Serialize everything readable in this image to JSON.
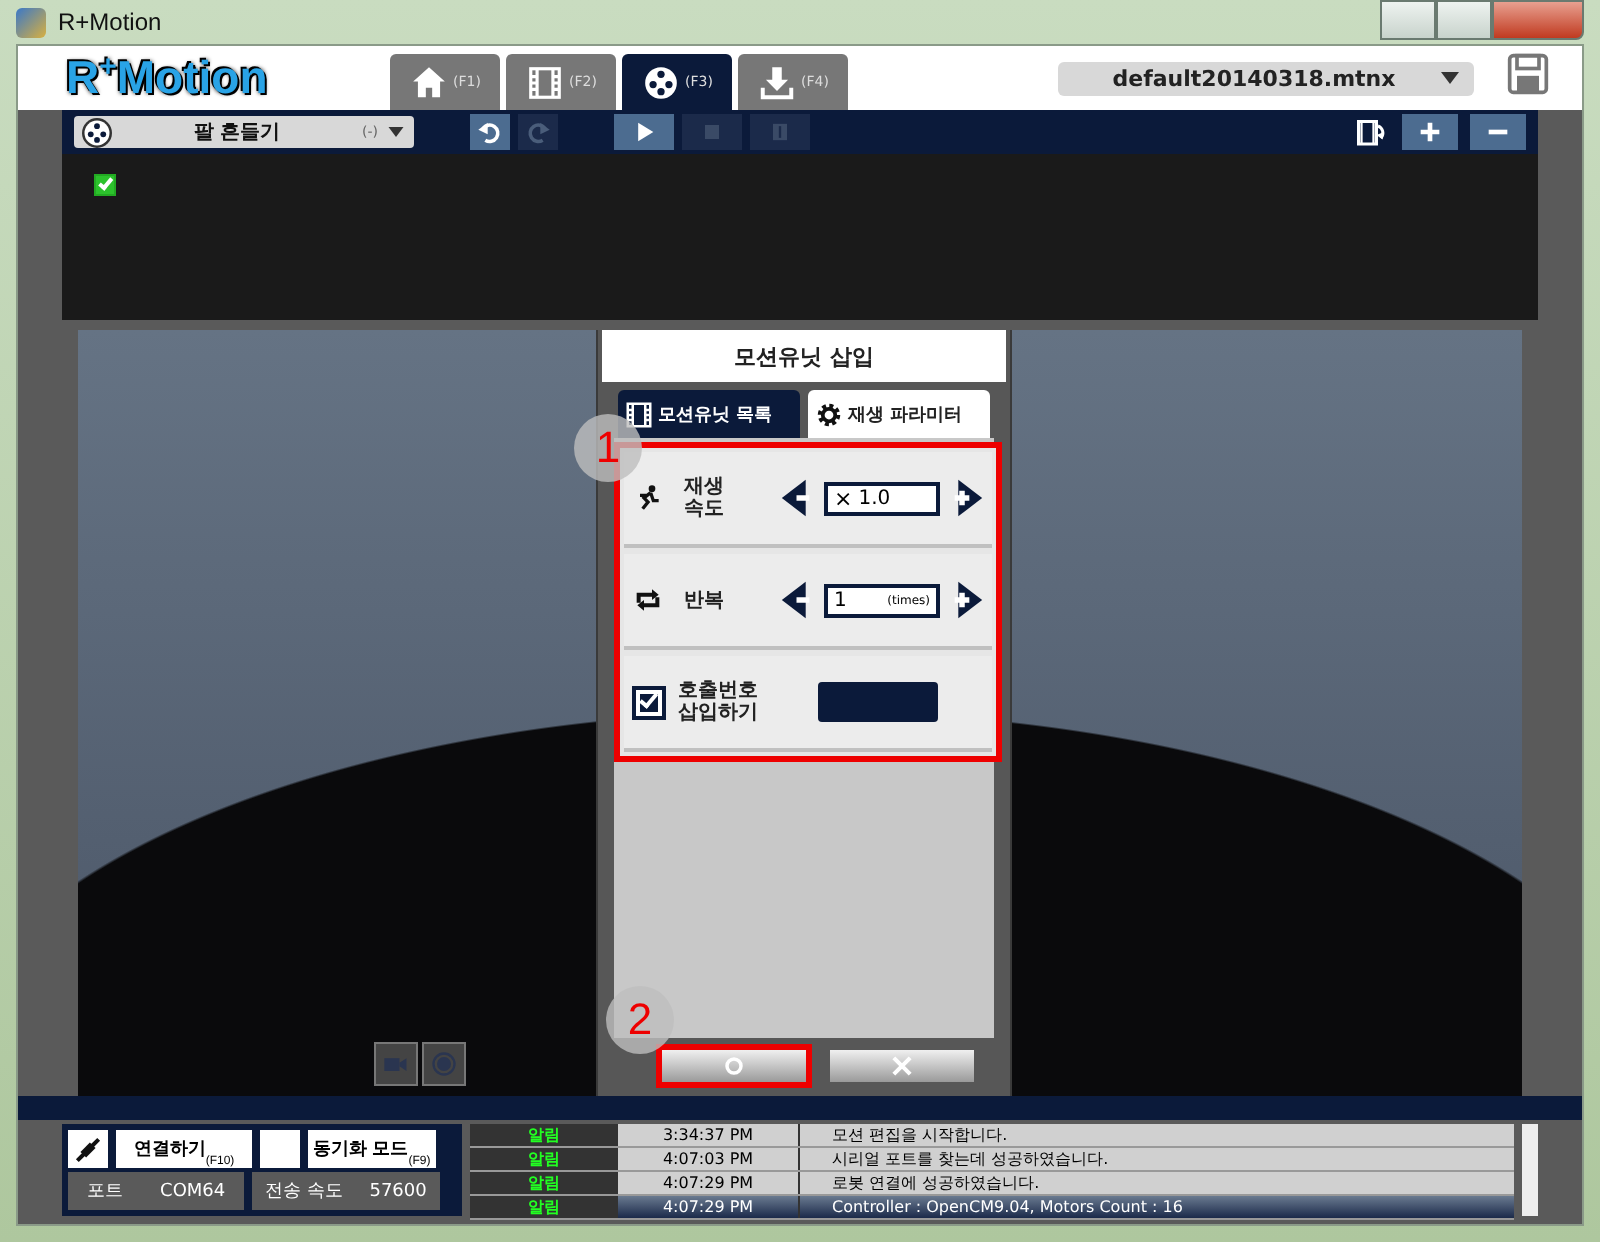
{
  "window": {
    "title": "R+Motion"
  },
  "logo": "R$^{+}$Motion",
  "tabs": [
    {
      "key": "(F1)",
      "selected": false
    },
    {
      "key": "(F2)",
      "selected": false
    },
    {
      "key": "(F3)",
      "selected": true
    },
    {
      "key": "(F4)",
      "selected": false
    }
  ],
  "file_select": {
    "value": "default20140318.mtnx"
  },
  "toolbar": {
    "motion_select": {
      "value": "팔 흔들기",
      "suffix": "(-)"
    },
    "buttons": [
      {
        "kind": "undo",
        "disabled": false
      },
      {
        "kind": "redo",
        "disabled": true
      },
      {
        "kind": "play",
        "disabled": false
      },
      {
        "kind": "stop",
        "disabled": true
      },
      {
        "kind": "pause",
        "disabled": true
      }
    ]
  },
  "timeline": {
    "checked": true
  },
  "dialog": {
    "title": "모션유닛 삽입",
    "tabs": [
      {
        "label": "모션유닛 목록",
        "selected": false
      },
      {
        "label": "재생 파라미터",
        "selected": true
      }
    ],
    "params": [
      {
        "kind": "speed",
        "label": "재생\n속도",
        "prefix": "×",
        "value": "1.0"
      },
      {
        "kind": "repeat",
        "label": "반복",
        "value": "1",
        "unit": "(times)"
      },
      {
        "kind": "call",
        "label": "호출번호\n삽입하기",
        "checked": true
      }
    ],
    "annotations": [
      "1",
      "2"
    ]
  },
  "status": {
    "connect": {
      "label": "연결하기",
      "key": "(F10)"
    },
    "sync": {
      "label": "동기화 모드",
      "key": "(F9)"
    },
    "port": {
      "label": "포트",
      "value": "COM64"
    },
    "baud": {
      "label": "전송 속도",
      "value": "57600"
    }
  },
  "log": [
    {
      "type": "알림",
      "time": "3:34:37 PM",
      "message": "모션 편집을 시작합니다.",
      "selected": false
    },
    {
      "type": "알림",
      "time": "4:07:03 PM",
      "message": "시리얼 포트를 찾는데 성공하였습니다.",
      "selected": false
    },
    {
      "type": "알림",
      "time": "4:07:29 PM",
      "message": "로봇 연결에 성공하였습니다.",
      "selected": false
    },
    {
      "type": "알림",
      "time": "4:07:29 PM",
      "message": "Controller : OpenCM9.04, Motors Count : 16",
      "selected": true
    }
  ]
}
